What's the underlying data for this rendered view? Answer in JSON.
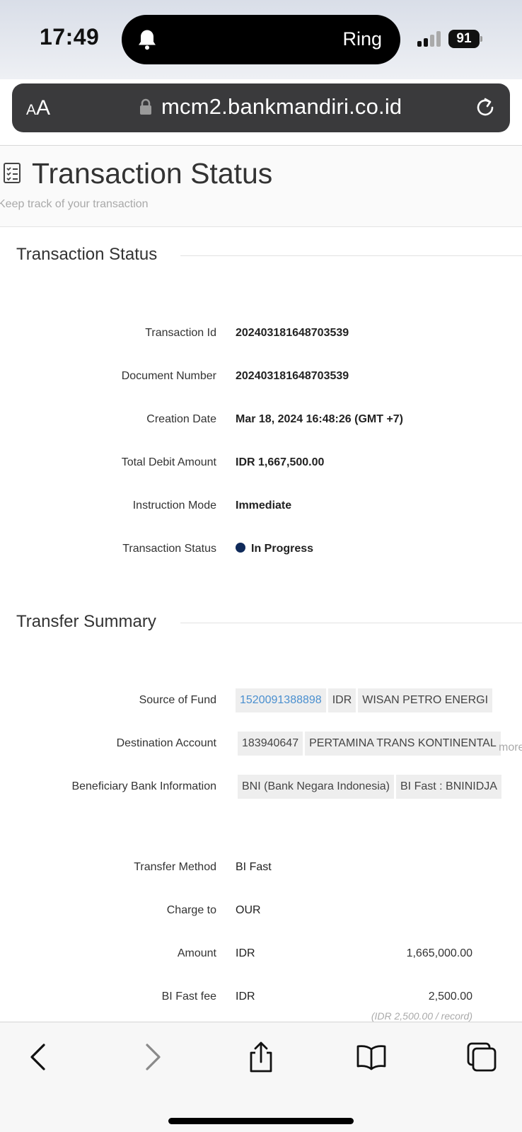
{
  "status_bar": {
    "time": "17:49",
    "activity": "Ring",
    "battery": "91"
  },
  "browser": {
    "text_size": "AA",
    "url": "mcm2.bankmandiri.co.id"
  },
  "page": {
    "title": "Transaction Status",
    "subtitle": "Keep track of your transaction"
  },
  "transaction": {
    "section_title": "Transaction Status",
    "rows": [
      {
        "label": "Transaction Id",
        "value": "202403181648703539"
      },
      {
        "label": "Document Number",
        "value": "202403181648703539"
      },
      {
        "label": "Creation Date",
        "value": "Mar 18, 2024 16:48:26 (GMT +7)"
      },
      {
        "label": "Total Debit Amount",
        "value": "IDR 1,667,500.00"
      },
      {
        "label": "Instruction Mode",
        "value": "Immediate"
      },
      {
        "label": "Transaction Status",
        "value": "In Progress"
      }
    ],
    "status_color": "#0f2a5a"
  },
  "transfer": {
    "section_title": "Transfer Summary",
    "source_of_fund": {
      "label": "Source of Fund",
      "account": "1520091388898",
      "currency": "IDR",
      "name": "WISAN PETRO ENERGI"
    },
    "destination": {
      "label": "Destination Account",
      "account": "183940647",
      "name": "PERTAMINA TRANS KONTINENTAL",
      "more": "more"
    },
    "beneficiary": {
      "label": "Beneficiary Bank Information",
      "bank": "BNI (Bank Negara Indonesia)",
      "code": "BI Fast : BNINIDJA"
    },
    "method": {
      "label": "Transfer Method",
      "value": "BI Fast"
    },
    "charge": {
      "label": "Charge to",
      "value": "OUR"
    },
    "amount": {
      "label": "Amount",
      "currency": "IDR",
      "value": "1,665,000.00"
    },
    "fee": {
      "label": "BI Fast fee",
      "currency": "IDR",
      "value": "2,500.00",
      "note": "(IDR 2,500.00 / record)"
    }
  },
  "toolbar": {
    "icons": [
      "back-icon",
      "forward-icon",
      "share-icon",
      "bookmarks-icon",
      "tabs-icon"
    ]
  },
  "colors": {
    "link": "#4a8fcf",
    "url_bar": "#3a3a3c"
  }
}
